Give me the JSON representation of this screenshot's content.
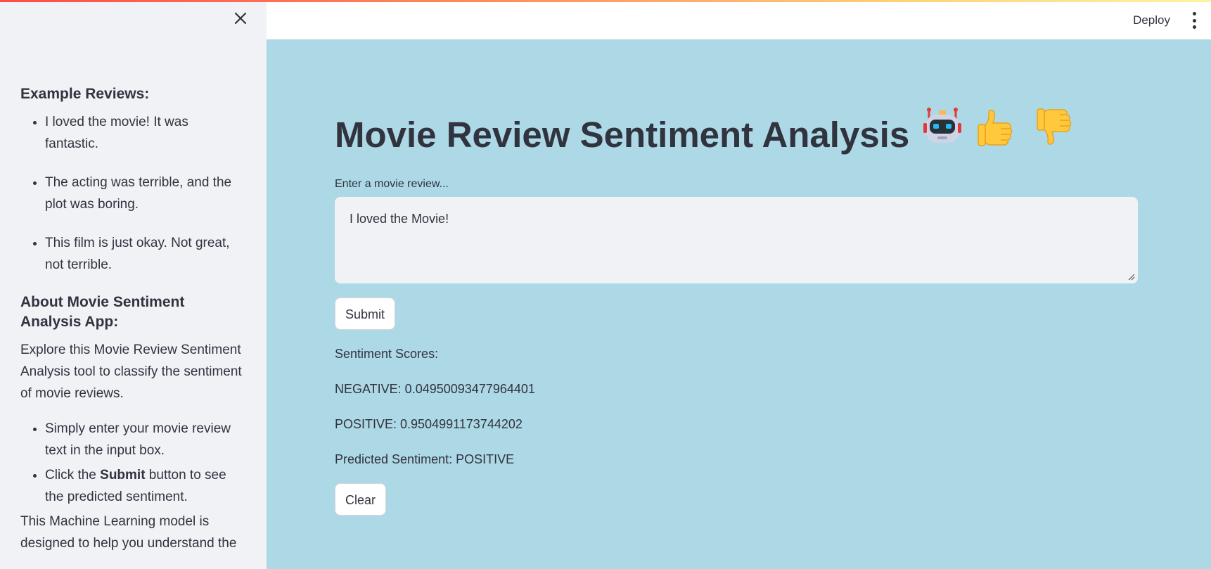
{
  "sidebar": {
    "examples_title": "Example Reviews:",
    "examples": [
      "I loved the movie! It was fantastic.",
      "The acting was terrible, and the plot was boring.",
      "This film is just okay. Not great, not terrible."
    ],
    "about_title": "About Movie Sentiment Analysis App:",
    "about_text": "Explore this Movie Review Sentiment Analysis tool to classify the sentiment of movie reviews.",
    "steps": [
      {
        "before": "Simply enter your movie review text in the input box.",
        "bold": "",
        "after": ""
      },
      {
        "before": "Click the ",
        "bold": "Submit",
        "after": " button to see the predicted sentiment."
      }
    ],
    "ml_text": "This Machine Learning model is designed to help you understand the"
  },
  "header": {
    "deploy_label": "Deploy"
  },
  "main": {
    "title": "Movie Review Sentiment Analysis",
    "input_label": "Enter a movie review...",
    "input_value": "I loved the Movie!",
    "submit_label": "Submit",
    "scores_title": "Sentiment Scores:",
    "negative_line": "NEGATIVE: 0.04950093477964401",
    "positive_line": "POSITIVE: 0.9504991173744202",
    "predicted_line": "Predicted Sentiment: POSITIVE",
    "clear_label": "Clear"
  },
  "icons": {
    "close": "close-icon",
    "menu": "kebab-menu-icon",
    "robot": "robot-emoji-icon",
    "thumbs_up": "thumbs-up-emoji-icon",
    "thumbs_down": "thumbs-down-emoji-icon"
  },
  "colors": {
    "main_background": "#add8e6",
    "sidebar_background": "#f0f2f6",
    "text": "#31333f",
    "accent": "#ff4b4b"
  }
}
